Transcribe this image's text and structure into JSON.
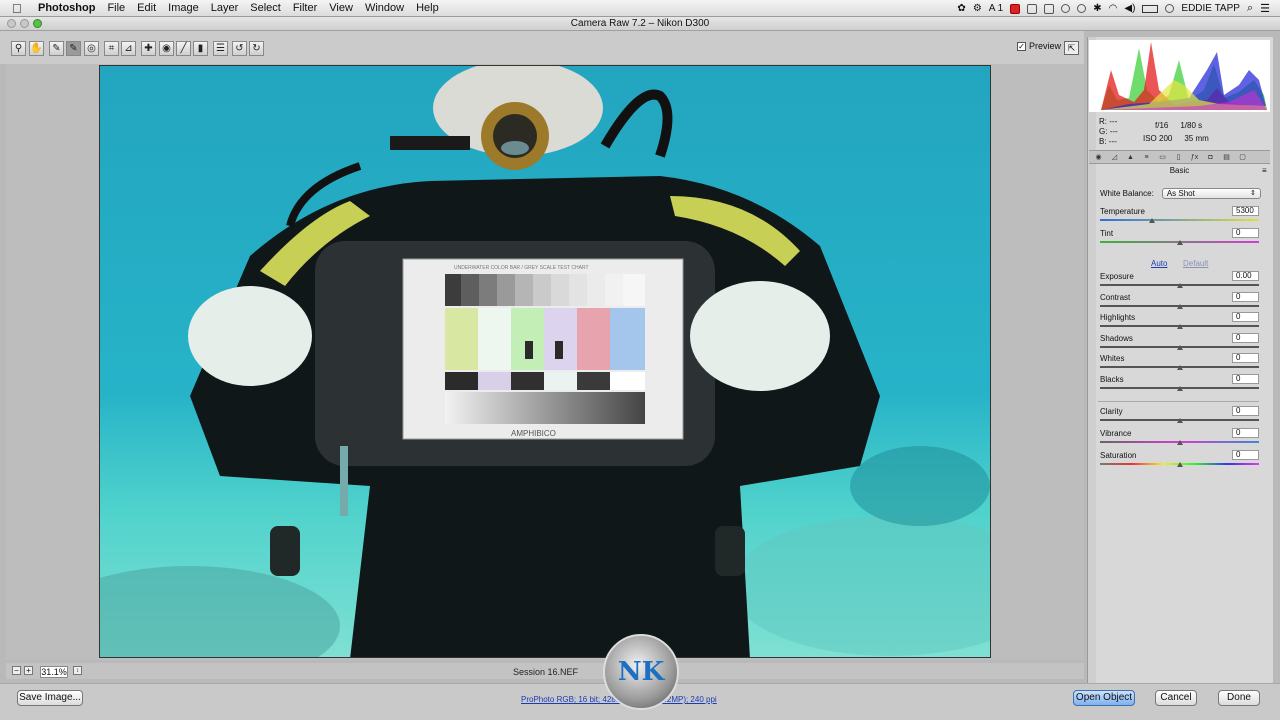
{
  "menubar": {
    "apple": "",
    "app_name": "Photoshop",
    "items": [
      "File",
      "Edit",
      "Image",
      "Layer",
      "Select",
      "Filter",
      "View",
      "Window",
      "Help"
    ],
    "status_a1": "A 1",
    "user": "EDDIE TAPP"
  },
  "window": {
    "title": "Camera Raw 7.2  –  Nikon D300"
  },
  "toolbar": {
    "tools": [
      "zoom-tool",
      "hand-tool",
      "white-balance-tool",
      "color-sampler-tool",
      "target-adjustment-tool",
      "crop-tool",
      "straighten-tool",
      "spot-removal-tool",
      "red-eye-tool",
      "adjustment-brush-tool",
      "graduated-filter-tool",
      "radial-filter-tool",
      "preferences",
      "rotate-ccw",
      "rotate-cw"
    ],
    "preview_label": "Preview",
    "preview_checked": true
  },
  "status": {
    "zoom": "31.1%",
    "filename": "Session 16.NEF"
  },
  "chart": {
    "title": "UNDERWATER COLOR BAR / GREY SCALE TEST CHART",
    "brand": "AMPHIBICO"
  },
  "info": {
    "r_label": "R:",
    "g_label": "G:",
    "b_label": "B:",
    "r_val": "---",
    "g_val": "---",
    "b_val": "---",
    "aperture": "f/16",
    "shutter": "1/80 s",
    "iso": "ISO 200",
    "focal": "35 mm"
  },
  "panel": {
    "name": "Basic",
    "white_balance_label": "White Balance:",
    "white_balance_value": "As Shot",
    "auto": "Auto",
    "default": "Default",
    "sliders": [
      {
        "label": "Temperature",
        "value": "5300",
        "level": 0.33
      },
      {
        "label": "Tint",
        "value": "0",
        "level": 0.5
      },
      {
        "label": "Exposure",
        "value": "0.00",
        "level": 0.5
      },
      {
        "label": "Contrast",
        "value": "0",
        "level": 0.5
      },
      {
        "label": "Highlights",
        "value": "0",
        "level": 0.5
      },
      {
        "label": "Shadows",
        "value": "0",
        "level": 0.5
      },
      {
        "label": "Whites",
        "value": "0",
        "level": 0.5
      },
      {
        "label": "Blacks",
        "value": "0",
        "level": 0.5
      },
      {
        "label": "Clarity",
        "value": "0",
        "level": 0.5
      },
      {
        "label": "Vibrance",
        "value": "0",
        "level": 0.5
      },
      {
        "label": "Saturation",
        "value": "0",
        "level": 0.5
      }
    ]
  },
  "buttons": {
    "save_image": "Save Image...",
    "open_object": "Open Object",
    "cancel": "Cancel",
    "done": "Done"
  },
  "workflow_link": "ProPhoto RGB; 16 bit; 4288 by 2848 (12.2MP); 240 ppi",
  "watermark": "NK"
}
